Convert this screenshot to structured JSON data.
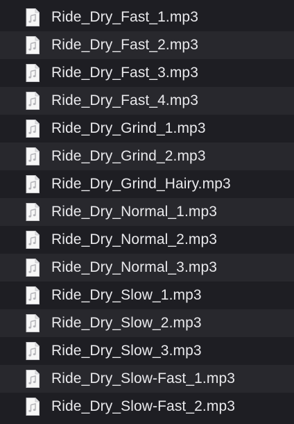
{
  "file_list": {
    "icon": "audio-file-icon",
    "items": [
      {
        "name": "Ride_Dry_Fast_1.mp3"
      },
      {
        "name": "Ride_Dry_Fast_2.mp3"
      },
      {
        "name": "Ride_Dry_Fast_3.mp3"
      },
      {
        "name": "Ride_Dry_Fast_4.mp3"
      },
      {
        "name": "Ride_Dry_Grind_1.mp3"
      },
      {
        "name": "Ride_Dry_Grind_2.mp3"
      },
      {
        "name": "Ride_Dry_Grind_Hairy.mp3"
      },
      {
        "name": "Ride_Dry_Normal_1.mp3"
      },
      {
        "name": "Ride_Dry_Normal_2.mp3"
      },
      {
        "name": "Ride_Dry_Normal_3.mp3"
      },
      {
        "name": "Ride_Dry_Slow_1.mp3"
      },
      {
        "name": "Ride_Dry_Slow_2.mp3"
      },
      {
        "name": "Ride_Dry_Slow_3.mp3"
      },
      {
        "name": "Ride_Dry_Slow-Fast_1.mp3"
      },
      {
        "name": "Ride_Dry_Slow-Fast_2.mp3"
      }
    ]
  }
}
